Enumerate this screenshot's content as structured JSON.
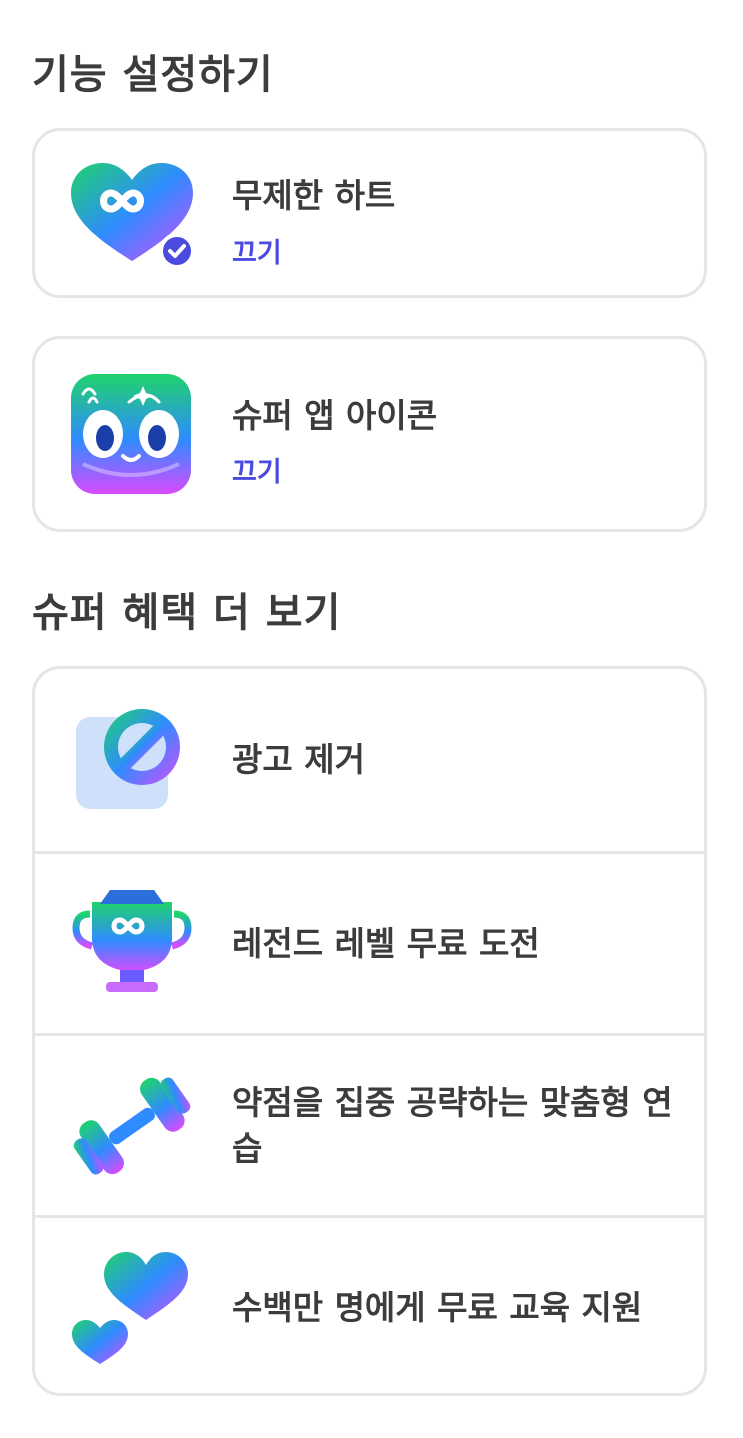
{
  "feature_settings": {
    "title": "기능 설정하기",
    "items": [
      {
        "title": "무제한 하트",
        "action": "끄기",
        "icon": "infinite-heart-icon"
      },
      {
        "title": "슈퍼 앱 아이콘",
        "action": "끄기",
        "icon": "super-app-icon"
      }
    ]
  },
  "more_benefits": {
    "title": "슈퍼 혜택 더 보기",
    "items": [
      {
        "label": "광고 제거",
        "icon": "no-ads-icon"
      },
      {
        "label": "레전드 레벨 무료 도전",
        "icon": "trophy-icon"
      },
      {
        "label": "약점을 집중 공략하는 맞춤형 연습",
        "icon": "dumbbell-icon"
      },
      {
        "label": "수백만 명에게 무료 교육 지원",
        "icon": "hearts-icon"
      }
    ]
  },
  "colors": {
    "action": "#4B4BE0",
    "text": "#3C3C3C",
    "border": "#E5E5E5",
    "gradient_start": "#1FD36B",
    "gradient_mid": "#2F8BFF",
    "gradient_end": "#D94BFF"
  }
}
